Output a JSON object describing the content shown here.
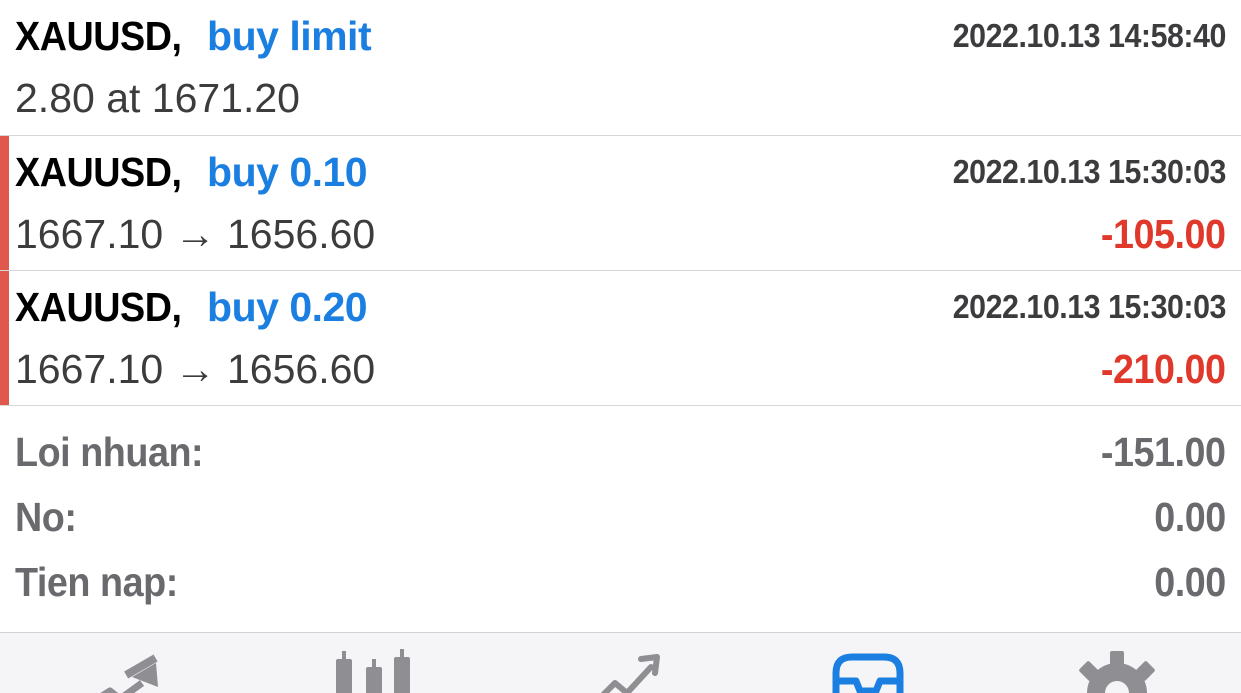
{
  "orders": [
    {
      "symbol": "XAUUSD,",
      "type": "buy limit",
      "time": "2022.10.13 14:58:40",
      "detail": "2.80 at 1671.20"
    }
  ],
  "positions": [
    {
      "symbol": "XAUUSD,",
      "type": "buy 0.10",
      "time": "2022.10.13 15:30:03",
      "prices": "1667.10 → 1656.60",
      "profit": "-105.00"
    },
    {
      "symbol": "XAUUSD,",
      "type": "buy 0.20",
      "time": "2022.10.13 15:30:03",
      "prices": "1667.10 → 1656.60",
      "profit": "-210.00"
    }
  ],
  "summary": [
    {
      "label": "Loi nhuan:",
      "value": "-151.00"
    },
    {
      "label": "No:",
      "value": "0.00"
    },
    {
      "label": "Tien nap:",
      "value": "0.00"
    }
  ],
  "tabbar": {
    "tabs": [
      {
        "icon": "quotes-icon",
        "active": false
      },
      {
        "icon": "chart-icon",
        "active": false
      },
      {
        "icon": "trade-icon",
        "active": false
      },
      {
        "icon": "history-icon",
        "active": true
      },
      {
        "icon": "settings-icon",
        "active": false
      }
    ]
  },
  "colors": {
    "accent": "#1a7fe0",
    "loss": "#e0392b",
    "marker": "#e0574c",
    "inactive_icon": "#8e8e93"
  }
}
